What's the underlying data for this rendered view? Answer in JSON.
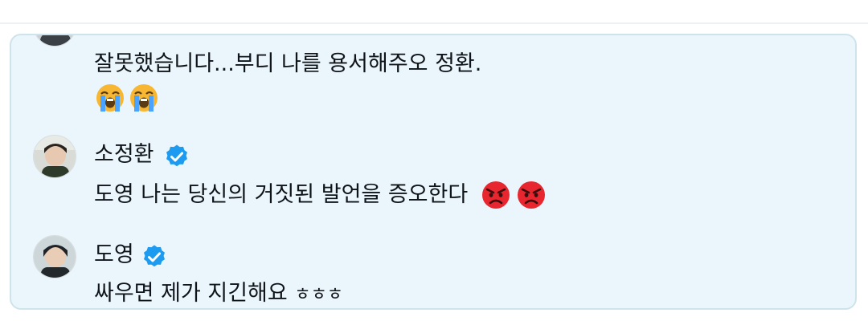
{
  "thread": {
    "items": [
      {
        "message": "잘못했습니다...부디 나를 용서해주오 정환.",
        "emojis": [
          "loudly-crying-face-emoji",
          "loudly-crying-face-emoji"
        ]
      },
      {
        "author": "소정환",
        "verified": true,
        "message": "도영 나는 당신의 거짓된 발언을 증오한다",
        "emojis": [
          "angry-face-emoji",
          "angry-face-emoji"
        ]
      },
      {
        "author": "도영",
        "verified": true,
        "message": "싸우면 제가 지긴해요",
        "laugh": "ㅎㅎㅎ"
      }
    ]
  },
  "colors": {
    "card_background": "#eaf6fc",
    "card_border": "#cfe3ea",
    "verified_badge": "#1d9bf0",
    "text": "#0f1419"
  }
}
